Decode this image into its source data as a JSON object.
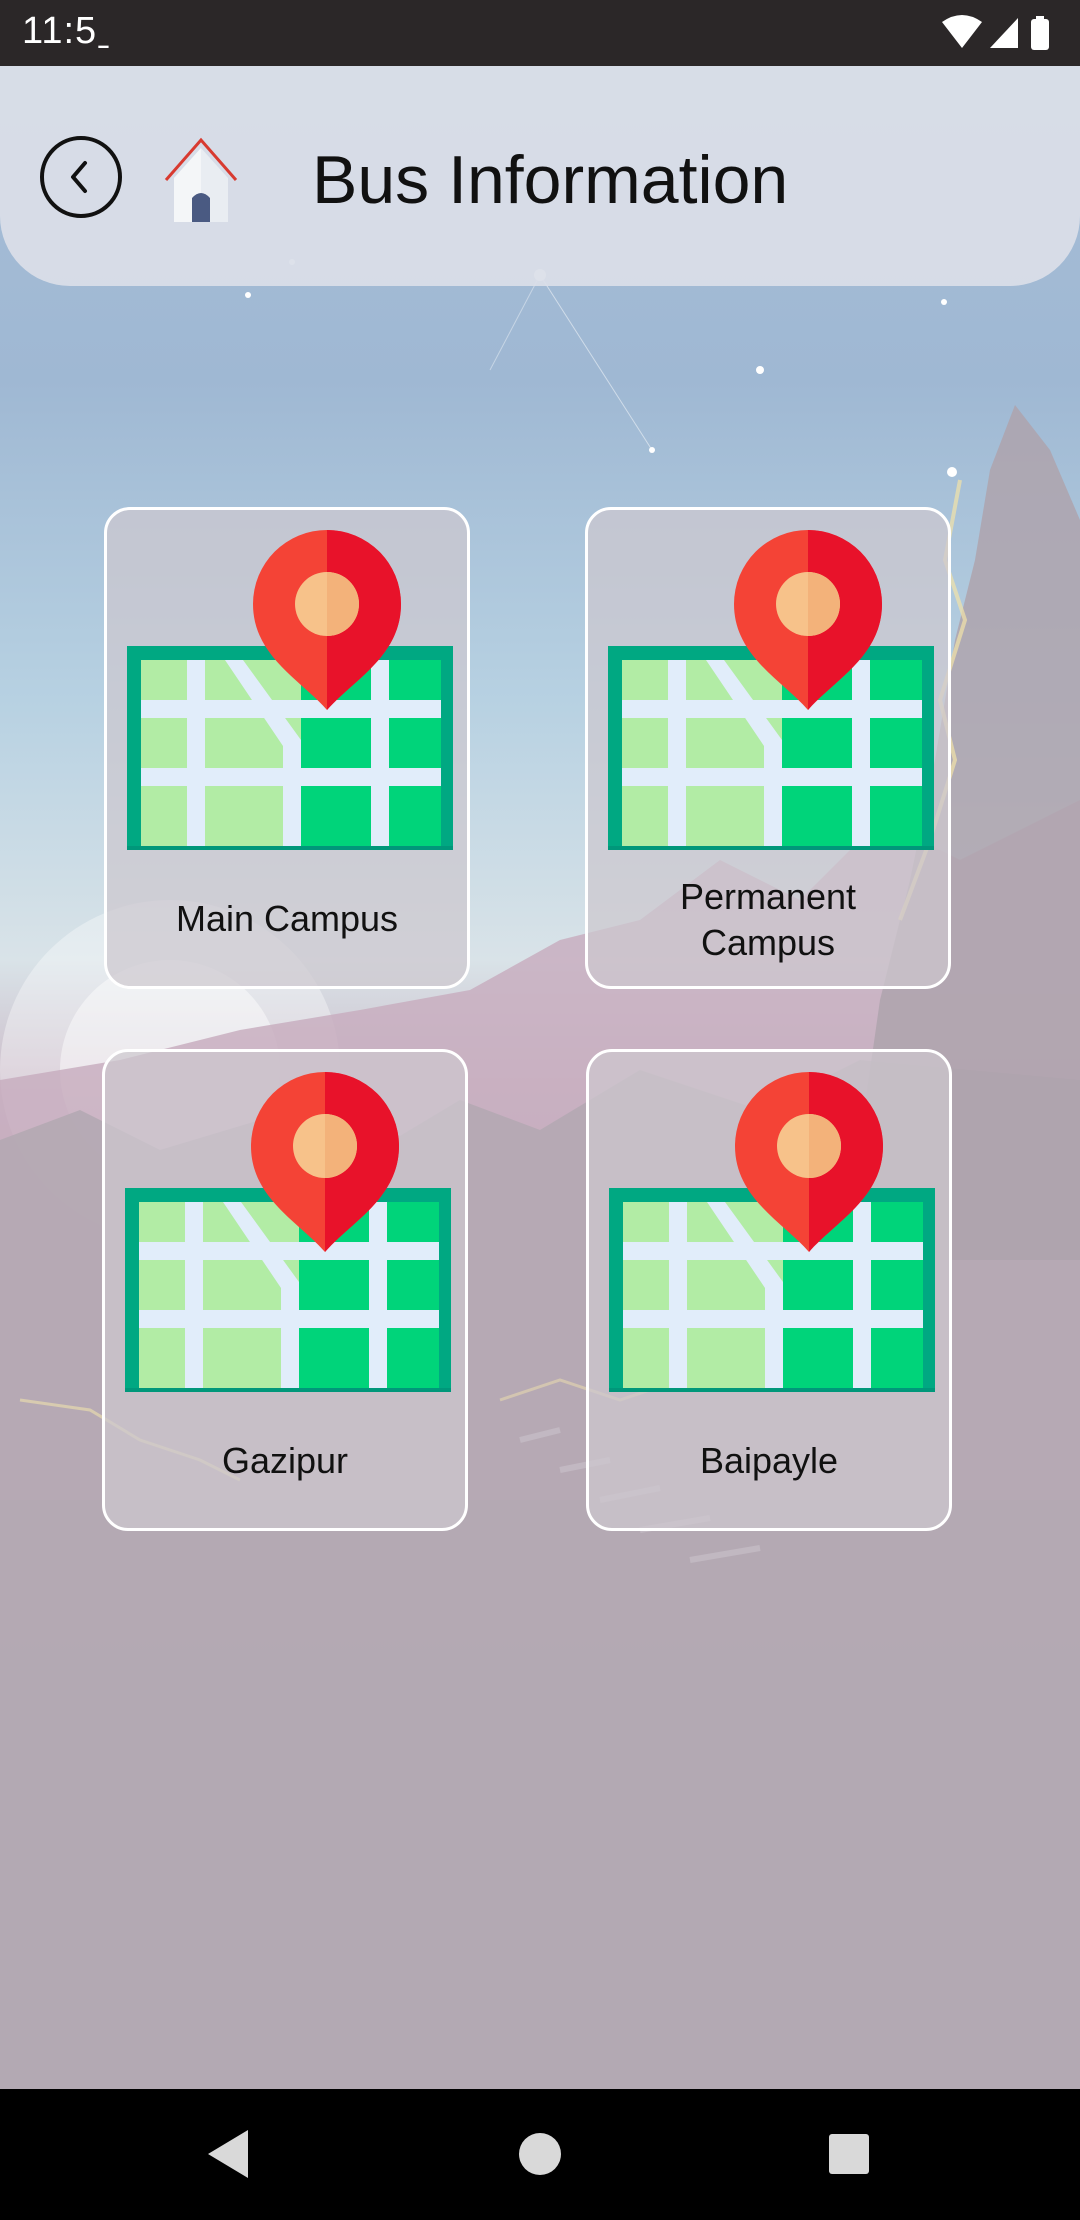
{
  "status_bar": {
    "time": "11:5ˍ",
    "icons": [
      "wifi-icon",
      "cellular-signal-icon",
      "battery-icon"
    ]
  },
  "header": {
    "title": "Bus Information",
    "back_icon": "back-arrow-circle-icon",
    "home_icon": "home-icon"
  },
  "cards": [
    {
      "label": "Main Campus",
      "icon": "map-pin-icon"
    },
    {
      "label": "Permanent Campus",
      "icon": "map-pin-icon"
    },
    {
      "label": "Gazipur",
      "icon": "map-pin-icon"
    },
    {
      "label": "Baipayle",
      "icon": "map-pin-icon"
    }
  ],
  "nav_bar": {
    "buttons": [
      "back-triangle-icon",
      "home-circle-icon",
      "recents-square-icon"
    ]
  },
  "colors": {
    "status_bar_bg": "#2b2728",
    "header_bg": "#dadfe8",
    "pin_red": "#f44336",
    "map_green": "#00d47a",
    "map_dark_green": "#00a882",
    "card_border": "#ffffff",
    "nav_bar_bg": "#000000"
  }
}
